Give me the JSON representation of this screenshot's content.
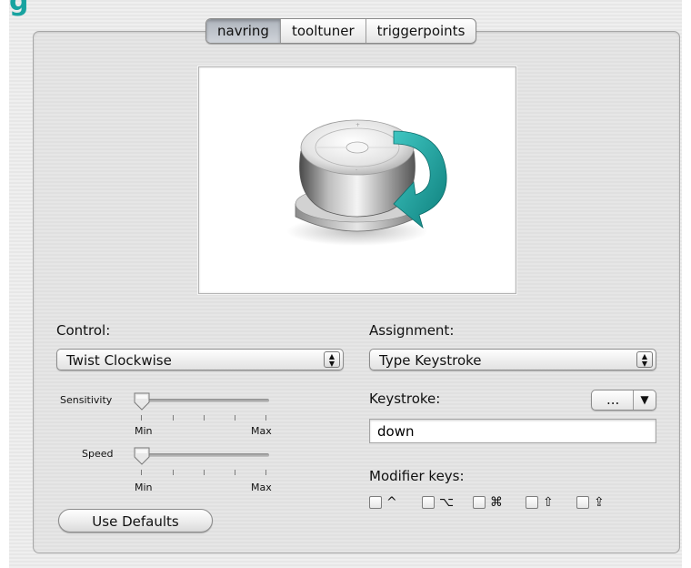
{
  "window": {
    "title_fragment": "g"
  },
  "tabs": [
    {
      "label": "navring",
      "selected": true
    },
    {
      "label": "tooltuner",
      "selected": false
    },
    {
      "label": "triggerpoints",
      "selected": false
    }
  ],
  "preview": {
    "image": "navring-twist-clockwise"
  },
  "control": {
    "label": "Control:",
    "selected": "Twist Clockwise"
  },
  "sensitivity": {
    "label": "Sensitivity",
    "min_label": "Min",
    "max_label": "Max",
    "value": 0
  },
  "speed": {
    "label": "Speed",
    "min_label": "Min",
    "max_label": "Max",
    "value": 0
  },
  "use_defaults_label": "Use Defaults",
  "assignment": {
    "label": "Assignment:",
    "selected": "Type Keystroke"
  },
  "keystroke": {
    "label": "Keystroke:",
    "value": "down",
    "menu_label": "..."
  },
  "modifiers": {
    "label": "Modifier keys:",
    "keys": [
      {
        "symbol": "^",
        "checked": false
      },
      {
        "symbol": "⌥",
        "checked": false
      },
      {
        "symbol": "⌘",
        "checked": false
      },
      {
        "symbol": "⇧",
        "checked": false
      },
      {
        "symbol": "⇪",
        "checked": false
      }
    ]
  },
  "colors": {
    "accent": "#18a3a0",
    "arrow_teal": "#1b9a97"
  }
}
